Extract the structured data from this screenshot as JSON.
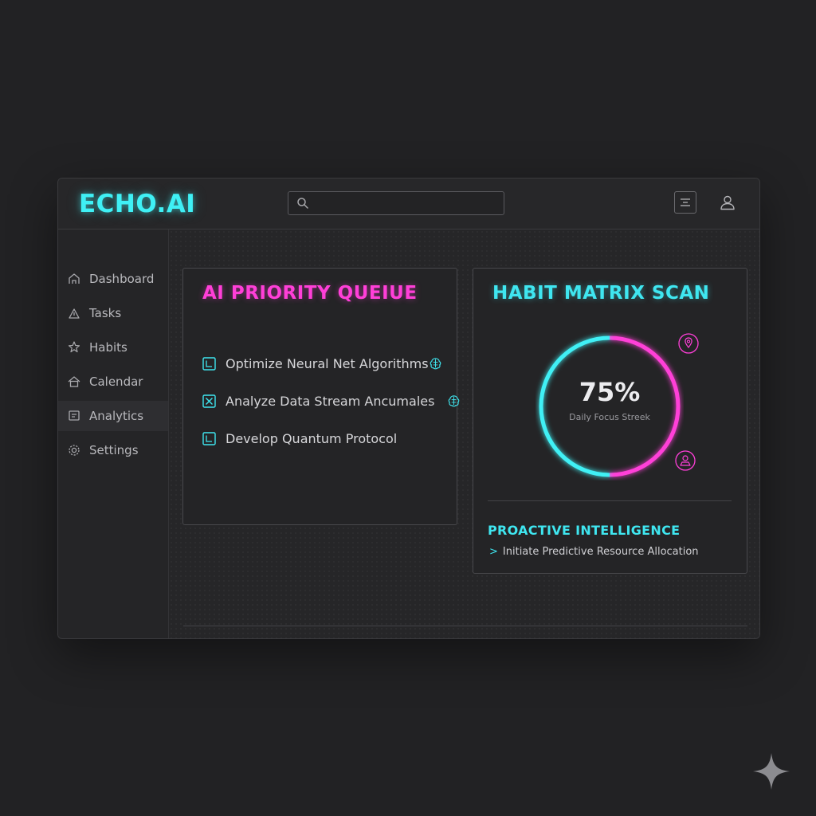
{
  "app": {
    "logo": "ECHO.AI"
  },
  "header": {
    "search_placeholder": "",
    "icons": [
      "menu-icon",
      "user-icon"
    ]
  },
  "sidebar": {
    "items": [
      {
        "label": "Dashboard",
        "icon": "home-icon"
      },
      {
        "label": "Tasks",
        "icon": "tasks-icon"
      },
      {
        "label": "Habits",
        "icon": "habits-icon"
      },
      {
        "label": "Calendar",
        "icon": "calendar-icon"
      },
      {
        "label": "Analytics",
        "icon": "analytics-icon",
        "active": true
      },
      {
        "label": "Settings",
        "icon": "gear-icon"
      }
    ]
  },
  "queue": {
    "title": "AI PRIORITY QUEIUE",
    "tasks": [
      {
        "label": "Optimize Neural Net Algorithms",
        "checked": false,
        "has_brain_icon": true
      },
      {
        "label": "Analyze Data Stream Ancumales",
        "checked": true,
        "has_brain_icon": true
      },
      {
        "label": "Develop Quantum Protocol",
        "checked": false,
        "has_brain_icon": false
      }
    ]
  },
  "habit": {
    "title": "HABIT MATRIX SCAN",
    "ring_value": "75%",
    "ring_caption": "Daily Focus Streek",
    "progress_fraction": 0.75,
    "icons": [
      "location-pin-icon",
      "person-badge-icon"
    ]
  },
  "insight": {
    "title": "PROACTIVE INTELLIGENCE",
    "item": "Initiate Predictive Resource Allocation"
  },
  "colors": {
    "cyan": "#3fe6f0",
    "magenta": "#ff3fd8",
    "background": "#222224",
    "panel": "#262628"
  }
}
